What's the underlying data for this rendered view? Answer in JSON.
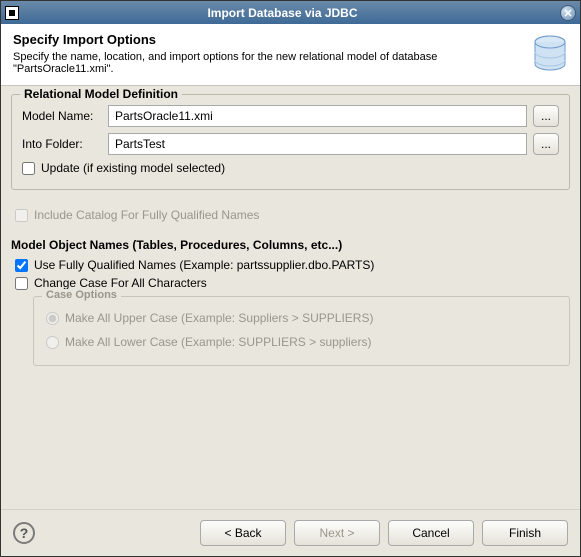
{
  "titlebar": {
    "title": "Import Database via JDBC"
  },
  "header": {
    "heading": "Specify Import Options",
    "description": "Specify the name, location, and import options for the new relational model of database \"PartsOracle11.xmi\"."
  },
  "relational_group": {
    "legend": "Relational Model Definition",
    "model_name_label": "Model Name:",
    "model_name_value": "PartsOracle11.xmi",
    "into_folder_label": "Into Folder:",
    "into_folder_value": "PartsTest",
    "browse_button": "...",
    "update_checkbox": {
      "label": "Update (if existing model selected)",
      "checked": false
    }
  },
  "include_catalog_checkbox": {
    "label": "Include Catalog For Fully Qualified Names",
    "checked": false,
    "enabled": false
  },
  "model_object_names": {
    "heading": "Model Object Names (Tables, Procedures, Columns, etc...)",
    "fully_qualified": {
      "label": "Use Fully Qualified Names  (Example: partssupplier.dbo.PARTS)",
      "checked": true
    },
    "change_case": {
      "label": "Change Case For All Characters",
      "checked": false
    },
    "case_options": {
      "legend": "Case Options",
      "upper": {
        "label": "Make All Upper Case  (Example: Suppliers > SUPPLIERS)",
        "selected": true,
        "enabled": false
      },
      "lower": {
        "label": "Make All Lower Case  (Example: SUPPLIERS > suppliers)",
        "selected": false,
        "enabled": false
      }
    }
  },
  "footer": {
    "back": "< Back",
    "next": "Next >",
    "cancel": "Cancel",
    "finish": "Finish"
  }
}
